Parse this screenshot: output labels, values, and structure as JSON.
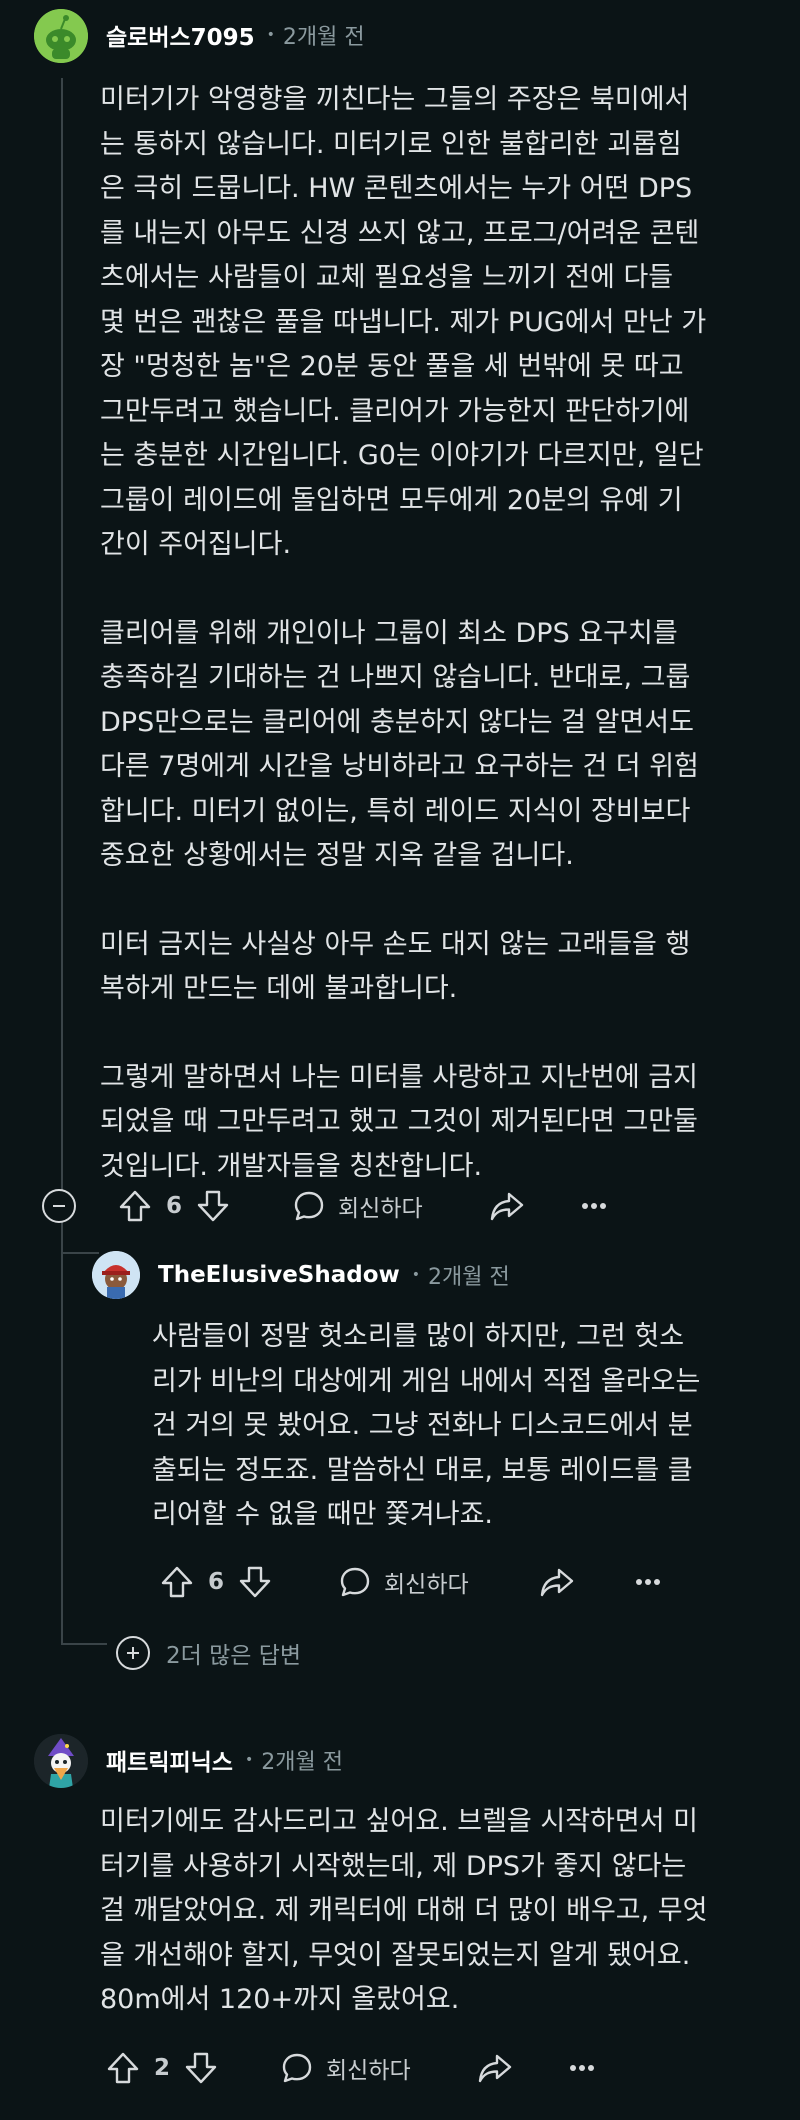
{
  "colors": {
    "background": "#0b1416",
    "thread_line": "#3a4448",
    "text": "#e1e4e6",
    "muted": "#8b9a9f"
  },
  "comment1": {
    "username": "슬로버스7095",
    "separator": "•",
    "time": "2개월 전",
    "avatar_icon": "reddit-snoo-icon",
    "body_lines": [
      "미터기가 악영향을 끼친다는 그들의 주장은 북미에서",
      "는 통하지 않습니다. 미터기로 인한 불합리한 괴롭힘",
      "은 극히 드뭅니다. HW 콘텐츠에서는 누가 어떤 DPS",
      "를 내는지 아무도 신경 쓰지 않고, 프로그/어려운 콘텐",
      "츠에서는 사람들이 교체 필요성을 느끼기 전에 다들",
      "몇 번은 괜찮은 풀을 따냅니다. 제가 PUG에서 만난 가",
      "장 \"멍청한 놈\"은 20분 동안 풀을 세 번밖에 못 따고",
      "그만두려고 했습니다. 클리어가 가능한지 판단하기에",
      "는 충분한 시간입니다. G0는 이야기가 다르지만, 일단",
      "그룹이 레이드에 돌입하면 모두에게 20분의 유예 기",
      "간이 주어집니다.",
      "",
      "클리어를 위해 개인이나 그룹이 최소 DPS 요구치를",
      "충족하길 기대하는 건 나쁘지 않습니다. 반대로, 그룹",
      "DPS만으로는 클리어에 충분하지 않다는 걸 알면서도",
      "다른 7명에게 시간을 낭비하라고 요구하는 건 더 위험",
      "합니다. 미터기 없이는, 특히 레이드 지식이 장비보다",
      "중요한 상황에서는 정말 지옥 같을 겁니다.",
      "",
      "미터 금지는 사실상 아무 손도 대지 않는 고래들을 행",
      "복하게 만드는 데에 불과합니다.",
      "",
      "그렇게 말하면서 나는 미터를 사랑하고 지난번에 금지",
      "되었을 때 그만두려고 했고 그것이 제거된다면 그만둘",
      "것입니다. 개발자들을 칭찬합니다."
    ],
    "votes": "6",
    "reply_label": "회신하다"
  },
  "reply1": {
    "username": "TheElusiveShadow",
    "separator": "•",
    "time": "2개월 전",
    "avatar_icon": "character-avatar-icon",
    "body_lines": [
      "사람들이 정말 헛소리를 많이 하지만, 그런 헛소",
      "리가 비난의 대상에게 게임 내에서 직접 올라오는",
      "건 거의 못 봤어요. 그냥 전화나 디스코드에서 분",
      "출되는 정도죠. 말씀하신 대로, 보통 레이드를 클",
      "리어할 수 없을 때만 쫓겨나죠."
    ],
    "votes": "6",
    "reply_label": "회신하다"
  },
  "more_replies": {
    "label": "2더 많은 답변"
  },
  "comment2": {
    "username": "패트릭피닉스",
    "separator": "•",
    "time": "2개월 전",
    "avatar_icon": "wizard-avatar-icon",
    "body_lines": [
      "미터기에도 감사드리고 싶어요. 브렐을 시작하면서 미",
      "터기를 사용하기 시작했는데, 제 DPS가 좋지 않다는",
      "걸 깨달았어요. 제 캐릭터에 대해 더 많이 배우고, 무엇",
      "을 개선해야 할지, 무엇이 잘못되었는지 알게 됐어요.",
      "80m에서 120+까지 올랐어요."
    ],
    "votes": "2",
    "reply_label": "회신하다"
  }
}
